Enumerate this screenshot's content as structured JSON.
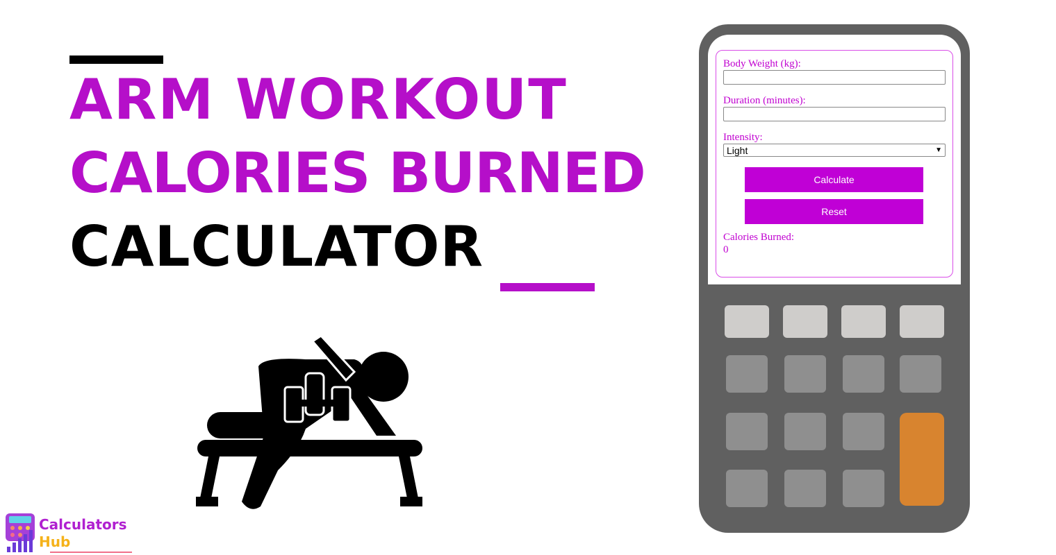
{
  "title": {
    "line1": "Arm Workout",
    "line2": "Calories Burned",
    "line3": "Calculator"
  },
  "colors": {
    "accent": "#b50fc9",
    "button": "#c000d6",
    "calc_body": "#606060",
    "key_light": "#cfcdcb",
    "key_gray": "#8f8f8f",
    "key_orange": "#d8842f"
  },
  "form": {
    "weight_label": "Body Weight (kg):",
    "weight_value": "",
    "duration_label": "Duration (minutes):",
    "duration_value": "",
    "intensity_label": "Intensity:",
    "intensity_value": "Light",
    "calculate_label": "Calculate",
    "reset_label": "Reset",
    "result_label": "Calories Burned:",
    "result_value": "0"
  },
  "logo": {
    "line1": "Calculators",
    "line2": "Hub"
  },
  "illustration_icon": "dumbbell-row-figure-icon"
}
